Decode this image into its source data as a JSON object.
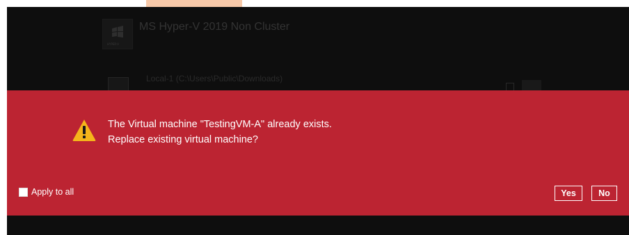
{
  "background_window": {
    "item_title": "MS Hyper-V 2019 Non Cluster",
    "location_title": "Local-1 (C:\\Users\\Public\\Downloads)"
  },
  "dialog": {
    "message_line1": "The Virtual machine \"TestingVM-A\" already exists.",
    "message_line2": "Replace existing virtual machine?",
    "apply_to_all_label": "Apply to all",
    "apply_to_all_checked": false,
    "yes_label": "Yes",
    "no_label": "No",
    "icon": "warning-icon"
  },
  "colors": {
    "dialog_background": "#bc2432",
    "warning_yellow": "#f5b51b",
    "page_dark": "#1b1b1b"
  }
}
